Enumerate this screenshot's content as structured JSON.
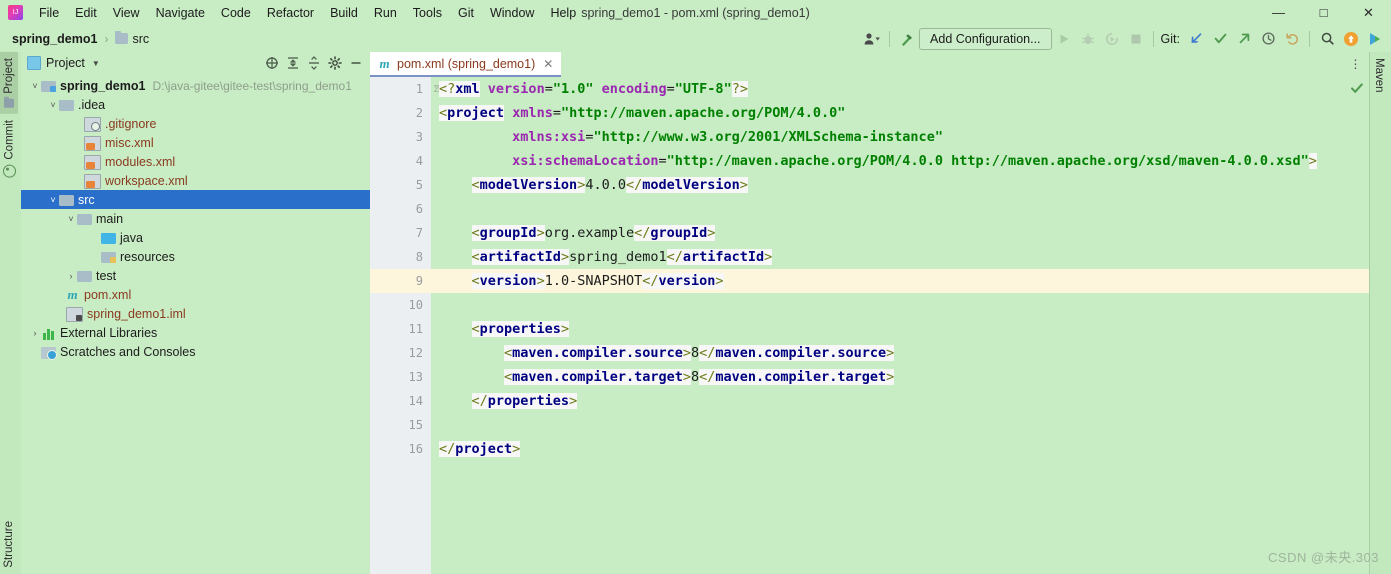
{
  "window": {
    "title": "spring_demo1 - pom.xml (spring_demo1)",
    "minimize_label": "—",
    "maximize_label": "□",
    "close_label": "✕",
    "logo_name": "intellij-idea-logo"
  },
  "menu": [
    {
      "label": "File"
    },
    {
      "label": "Edit"
    },
    {
      "label": "View"
    },
    {
      "label": "Navigate"
    },
    {
      "label": "Code"
    },
    {
      "label": "Refactor"
    },
    {
      "label": "Build"
    },
    {
      "label": "Run"
    },
    {
      "label": "Tools"
    },
    {
      "label": "Git"
    },
    {
      "label": "Window"
    },
    {
      "label": "Help"
    }
  ],
  "navbar": {
    "breadcrumbs": [
      {
        "label": "spring_demo1",
        "bold": true
      },
      {
        "label": "src",
        "bold": false
      }
    ],
    "separator": "›",
    "add_configuration_label": "Add Configuration...",
    "git_label": "Git:"
  },
  "left_strip": [
    {
      "label": "Project",
      "active": true
    },
    {
      "label": "Commit",
      "active": false
    },
    {
      "label": "Structure",
      "active": false
    }
  ],
  "right_strip": [
    {
      "label": "Maven",
      "active": false
    }
  ],
  "project_panel": {
    "title": "Project",
    "tree": [
      {
        "label": "spring_demo1",
        "path": "D:\\java-gitee\\gitee-test\\spring_demo1",
        "indent": 0,
        "arrow": "˅",
        "icon": "module-folder",
        "bold": true,
        "selected": false
      },
      {
        "label": ".idea",
        "path": "",
        "indent": 1,
        "arrow": "˅",
        "icon": "folder",
        "bold": false,
        "selected": false
      },
      {
        "label": ".gitignore",
        "path": "",
        "indent": 2,
        "arrow": "",
        "icon": "gitignore-file",
        "bold": false,
        "selected": false
      },
      {
        "label": "misc.xml",
        "path": "",
        "indent": 2,
        "arrow": "",
        "icon": "xml-file",
        "bold": false,
        "selected": false
      },
      {
        "label": "modules.xml",
        "path": "",
        "indent": 2,
        "arrow": "",
        "icon": "xml-file",
        "bold": false,
        "selected": false
      },
      {
        "label": "workspace.xml",
        "path": "",
        "indent": 2,
        "arrow": "",
        "icon": "xml-file",
        "bold": false,
        "selected": false
      },
      {
        "label": "src",
        "path": "",
        "indent": 1,
        "arrow": "˅",
        "icon": "folder",
        "bold": false,
        "selected": true
      },
      {
        "label": "main",
        "path": "",
        "indent": 2,
        "arrow": "˅",
        "icon": "folder",
        "bold": false,
        "selected": false
      },
      {
        "label": "java",
        "path": "",
        "indent": 3,
        "arrow": "",
        "icon": "source-folder",
        "bold": false,
        "selected": false
      },
      {
        "label": "resources",
        "path": "",
        "indent": 3,
        "arrow": "",
        "icon": "resource-folder",
        "bold": false,
        "selected": false
      },
      {
        "label": "test",
        "path": "",
        "indent": 2,
        "arrow": "›",
        "icon": "folder",
        "bold": false,
        "selected": false
      },
      {
        "label": "pom.xml",
        "path": "",
        "indent": 2,
        "arrow": "",
        "icon": "maven-file",
        "bold": false,
        "selected": false
      },
      {
        "label": "spring_demo1.iml",
        "path": "",
        "indent": 2,
        "arrow": "",
        "icon": "iml-file",
        "bold": false,
        "selected": false
      },
      {
        "label": "External Libraries",
        "path": "",
        "indent": 0,
        "arrow": "›",
        "icon": "library",
        "bold": false,
        "selected": false,
        "dark": true
      },
      {
        "label": "Scratches and Consoles",
        "path": "",
        "indent": 0,
        "arrow": "",
        "icon": "scratches",
        "bold": false,
        "selected": false,
        "dark": true
      }
    ]
  },
  "editor": {
    "tab": {
      "label": "pom.xml (spring_demo1)",
      "close": "✕",
      "icon": "maven-m-icon"
    },
    "current_line": 9,
    "lines": [
      {
        "n": 1,
        "fold": "",
        "bulb": false,
        "tokens": [
          {
            "t": "<?",
            "c": "br"
          },
          {
            "t": "xml",
            "c": "tag"
          },
          {
            "t": " ",
            "c": "txt"
          },
          {
            "t": "version",
            "c": "attr"
          },
          {
            "t": "=",
            "c": "eq"
          },
          {
            "t": "\"1.0\"",
            "c": "val"
          },
          {
            "t": " ",
            "c": "txt"
          },
          {
            "t": "encoding",
            "c": "attr"
          },
          {
            "t": "=",
            "c": "eq"
          },
          {
            "t": "\"UTF-8\"",
            "c": "val"
          },
          {
            "t": "?>",
            "c": "br"
          }
        ]
      },
      {
        "n": 2,
        "fold": "open",
        "bulb": false,
        "tokens": [
          {
            "t": "<",
            "c": "br"
          },
          {
            "t": "project",
            "c": "tag"
          },
          {
            "t": " ",
            "c": "txt"
          },
          {
            "t": "xmlns",
            "c": "attr"
          },
          {
            "t": "=",
            "c": "eq"
          },
          {
            "t": "\"http://maven.apache.org/POM/4.0.0\"",
            "c": "val"
          }
        ]
      },
      {
        "n": 3,
        "fold": "",
        "bulb": false,
        "tokens": [
          {
            "t": "         ",
            "c": "txt"
          },
          {
            "t": "xmlns:xsi",
            "c": "attr"
          },
          {
            "t": "=",
            "c": "eq"
          },
          {
            "t": "\"http://www.w3.org/2001/XMLSchema-instance\"",
            "c": "val"
          }
        ]
      },
      {
        "n": 4,
        "fold": "",
        "bulb": false,
        "tokens": [
          {
            "t": "         ",
            "c": "txt"
          },
          {
            "t": "xsi:schemaLocation",
            "c": "attr"
          },
          {
            "t": "=",
            "c": "eq"
          },
          {
            "t": "\"http://maven.apache.org/POM/4.0.0 http://maven.apache.org/xsd/maven-4.0.0.xsd\"",
            "c": "val"
          },
          {
            "t": ">",
            "c": "br"
          }
        ]
      },
      {
        "n": 5,
        "fold": "",
        "bulb": false,
        "tokens": [
          {
            "t": "    ",
            "c": "txt"
          },
          {
            "t": "<",
            "c": "br"
          },
          {
            "t": "modelVersion",
            "c": "tag"
          },
          {
            "t": ">",
            "c": "br"
          },
          {
            "t": "4.0.0",
            "c": "txt"
          },
          {
            "t": "</",
            "c": "br"
          },
          {
            "t": "modelVersion",
            "c": "tag"
          },
          {
            "t": ">",
            "c": "br"
          }
        ]
      },
      {
        "n": 6,
        "fold": "",
        "bulb": false,
        "tokens": []
      },
      {
        "n": 7,
        "fold": "",
        "bulb": false,
        "tokens": [
          {
            "t": "    ",
            "c": "txt"
          },
          {
            "t": "<",
            "c": "br"
          },
          {
            "t": "groupId",
            "c": "tag"
          },
          {
            "t": ">",
            "c": "br"
          },
          {
            "t": "org.example",
            "c": "txt"
          },
          {
            "t": "</",
            "c": "br"
          },
          {
            "t": "groupId",
            "c": "tag"
          },
          {
            "t": ">",
            "c": "br"
          }
        ]
      },
      {
        "n": 8,
        "fold": "",
        "bulb": false,
        "tokens": [
          {
            "t": "    ",
            "c": "txt"
          },
          {
            "t": "<",
            "c": "br"
          },
          {
            "t": "artifactId",
            "c": "tag"
          },
          {
            "t": ">",
            "c": "br"
          },
          {
            "t": "spring_demo1",
            "c": "txt"
          },
          {
            "t": "</",
            "c": "br"
          },
          {
            "t": "artifactId",
            "c": "tag"
          },
          {
            "t": ">",
            "c": "br"
          }
        ]
      },
      {
        "n": 9,
        "fold": "",
        "bulb": true,
        "tokens": [
          {
            "t": "    ",
            "c": "txt"
          },
          {
            "t": "<",
            "c": "br"
          },
          {
            "t": "version",
            "c": "tag"
          },
          {
            "t": ">",
            "c": "br"
          },
          {
            "t": "1.0-SNAPSHOT",
            "c": "txt"
          },
          {
            "t": "</",
            "c": "br"
          },
          {
            "t": "version",
            "c": "tag"
          },
          {
            "t": ">",
            "c": "br"
          }
        ]
      },
      {
        "n": 10,
        "fold": "",
        "bulb": false,
        "tokens": []
      },
      {
        "n": 11,
        "fold": "open",
        "bulb": false,
        "tokens": [
          {
            "t": "    ",
            "c": "txt"
          },
          {
            "t": "<",
            "c": "br"
          },
          {
            "t": "properties",
            "c": "tag"
          },
          {
            "t": ">",
            "c": "br"
          }
        ]
      },
      {
        "n": 12,
        "fold": "",
        "bulb": false,
        "tokens": [
          {
            "t": "        ",
            "c": "txt"
          },
          {
            "t": "<",
            "c": "br"
          },
          {
            "t": "maven.compiler.source",
            "c": "tag"
          },
          {
            "t": ">",
            "c": "br"
          },
          {
            "t": "8",
            "c": "txt"
          },
          {
            "t": "</",
            "c": "br"
          },
          {
            "t": "maven.compiler.source",
            "c": "tag"
          },
          {
            "t": ">",
            "c": "br"
          }
        ]
      },
      {
        "n": 13,
        "fold": "",
        "bulb": false,
        "tokens": [
          {
            "t": "        ",
            "c": "txt"
          },
          {
            "t": "<",
            "c": "br"
          },
          {
            "t": "maven.compiler.target",
            "c": "tag"
          },
          {
            "t": ">",
            "c": "br"
          },
          {
            "t": "8",
            "c": "txt"
          },
          {
            "t": "</",
            "c": "br"
          },
          {
            "t": "maven.compiler.target",
            "c": "tag"
          },
          {
            "t": ">",
            "c": "br"
          }
        ]
      },
      {
        "n": 14,
        "fold": "close",
        "bulb": false,
        "tokens": [
          {
            "t": "    ",
            "c": "txt"
          },
          {
            "t": "</",
            "c": "br"
          },
          {
            "t": "properties",
            "c": "tag"
          },
          {
            "t": ">",
            "c": "br"
          }
        ]
      },
      {
        "n": 15,
        "fold": "",
        "bulb": false,
        "tokens": []
      },
      {
        "n": 16,
        "fold": "close",
        "bulb": false,
        "tokens": [
          {
            "t": "</",
            "c": "br"
          },
          {
            "t": "project",
            "c": "tag"
          },
          {
            "t": ">",
            "c": "br"
          }
        ]
      }
    ]
  },
  "watermark": "CSDN @未央.303",
  "colors": {
    "background": "#c8ecc4",
    "selection": "#2a6fc9",
    "current_line": "#fdf6dd",
    "gutter": "#eceff1",
    "tag": "#000080",
    "attribute": "#9b27b0",
    "value": "#008000",
    "bracket": "#6a7b16"
  }
}
